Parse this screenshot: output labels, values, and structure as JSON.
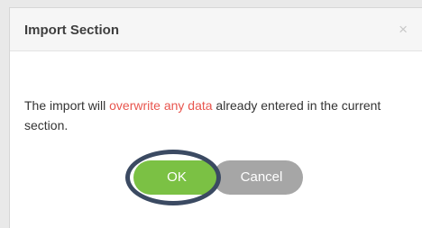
{
  "dialog": {
    "title": "Import Section",
    "close_glyph": "×",
    "message": {
      "prefix": "The import will ",
      "highlight": "overwrite any data",
      "suffix": " already entered in the current section."
    },
    "ok_label": "OK",
    "cancel_label": "Cancel"
  },
  "colors": {
    "ok_button": "#7bc144",
    "cancel_button": "#a6a6a6",
    "highlight_text": "#e8554e",
    "annotation_ring": "#3b4a62"
  },
  "icons": {
    "close": "close-icon"
  }
}
